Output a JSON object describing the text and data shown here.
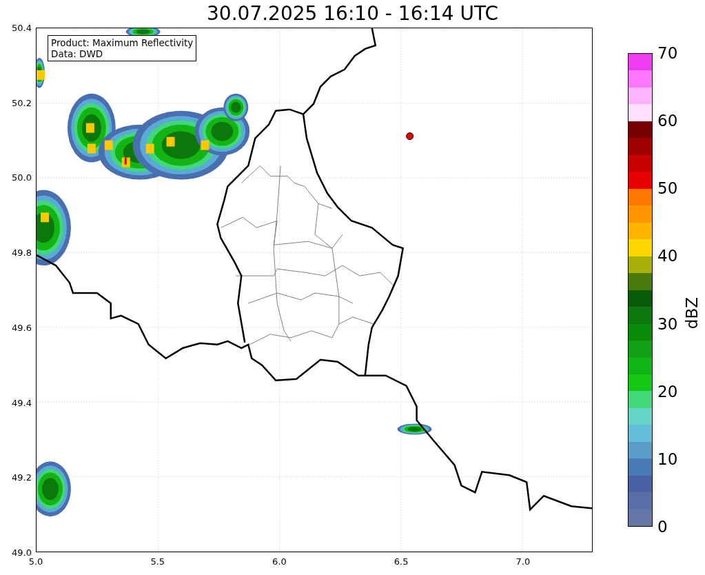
{
  "title": "30.07.2025 16:10 - 16:14 UTC",
  "map": {
    "info_lines": [
      "Product: Maximum Reflectivity",
      "Data: DWD"
    ],
    "yticks": [
      "50.4",
      "50.2",
      "50.0",
      "49.8",
      "49.6",
      "49.4",
      "49.2",
      "49.0"
    ],
    "xticks": [
      "5.0",
      "5.5",
      "6.0",
      "6.5",
      "7.0"
    ]
  },
  "colorbar": {
    "label": "dBZ",
    "ticks": [
      "70",
      "60",
      "50",
      "40",
      "30",
      "20",
      "10",
      "0"
    ],
    "segments": [
      {
        "color": "#f03cf0"
      },
      {
        "color": "#ff78ff"
      },
      {
        "color": "#ffb4ff"
      },
      {
        "color": "#ffe0ff"
      },
      {
        "color": "#780000"
      },
      {
        "color": "#a00000"
      },
      {
        "color": "#c80000"
      },
      {
        "color": "#e60000"
      },
      {
        "color": "#ff7800"
      },
      {
        "color": "#ff9600"
      },
      {
        "color": "#ffb400"
      },
      {
        "color": "#ffd700"
      },
      {
        "color": "#aab00a"
      },
      {
        "color": "#4a7a0a"
      },
      {
        "color": "#085a08"
      },
      {
        "color": "#0a780a"
      },
      {
        "color": "#0a8c0a"
      },
      {
        "color": "#10a014"
      },
      {
        "color": "#10b414"
      },
      {
        "color": "#14c814"
      },
      {
        "color": "#40d878"
      },
      {
        "color": "#64d6c8"
      },
      {
        "color": "#64bedc"
      },
      {
        "color": "#5a9ec8"
      },
      {
        "color": "#4a7ab4"
      },
      {
        "color": "#4a62a3"
      },
      {
        "color": "#5a6ea8"
      },
      {
        "color": "#6477a8"
      }
    ]
  }
}
